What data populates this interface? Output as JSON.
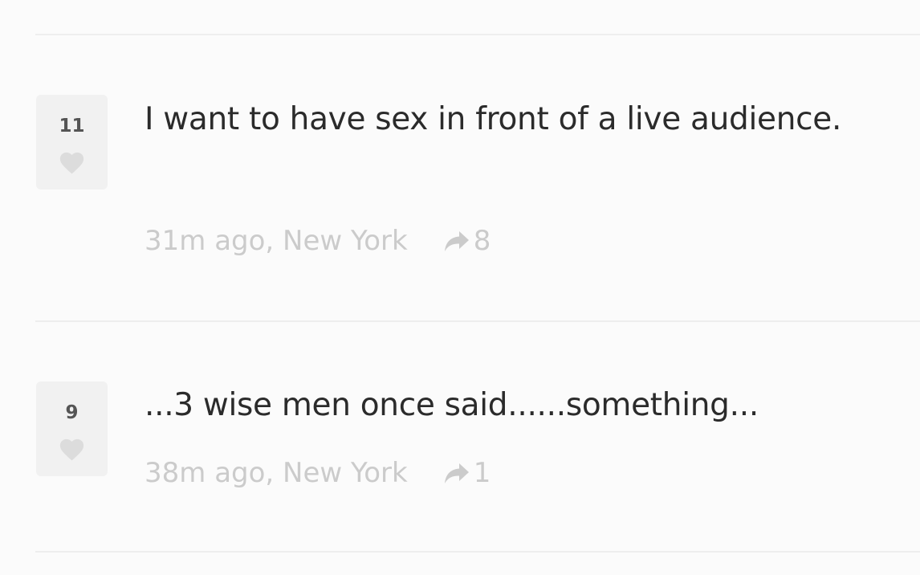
{
  "posts": [
    {
      "votes": "11",
      "text": "I want to have sex in front of a live audience.",
      "meta": "31m ago, New York",
      "shares": "8"
    },
    {
      "votes": "9",
      "text": "...3 wise men once said......something...",
      "meta": "38m ago, New York",
      "shares": "1"
    }
  ],
  "icons": {
    "vote": "heart-icon",
    "share": "share-arrow-icon"
  },
  "colors": {
    "background": "#fbfbfb",
    "vote_box": "#f1f1f1",
    "text": "#2b2b2b",
    "meta": "#cbcbcb",
    "divider": "#eeeeee"
  }
}
